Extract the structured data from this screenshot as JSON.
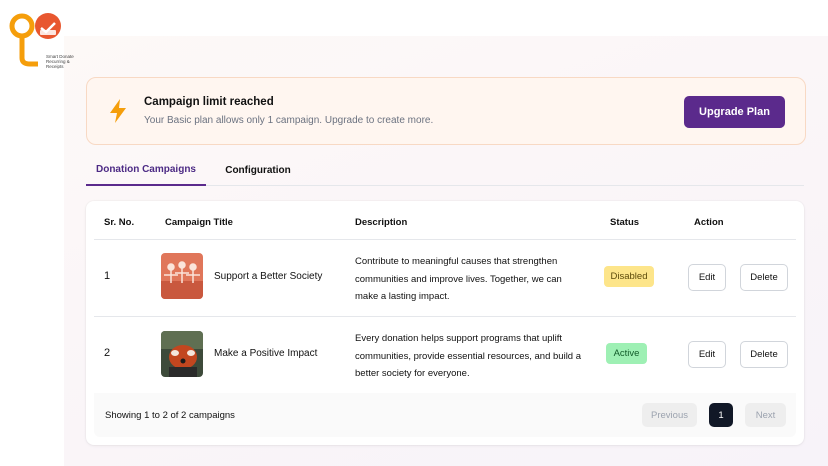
{
  "brand": {
    "logo_text": "Smart Donate Recurring & Receipts",
    "colors": {
      "orange": "#f59e0b",
      "accent": "#5b2a8c"
    }
  },
  "alert": {
    "icon": "lightning-icon",
    "title": "Campaign limit reached",
    "description": "Your Basic plan allows only 1 campaign. Upgrade to create more.",
    "button_label": "Upgrade Plan"
  },
  "tabs": [
    {
      "label": "Donation Campaigns",
      "active": true
    },
    {
      "label": "Configuration",
      "active": false
    }
  ],
  "table": {
    "headers": [
      "Sr. No.",
      "Campaign Title",
      "Description",
      "Status",
      "Action"
    ],
    "rows": [
      {
        "sr": "1",
        "title": "Support a Better Society",
        "description": "Contribute to meaningful causes that strengthen communities and improve lives. Together, we can make a lasting impact.",
        "status": "Disabled",
        "edit": "Edit",
        "delete": "Delete"
      },
      {
        "sr": "2",
        "title": "Make a Positive Impact",
        "description": "Every donation helps support programs that uplift communities, provide essential resources, and build a better society for everyone.",
        "status": "Active",
        "edit": "Edit",
        "delete": "Delete"
      }
    ]
  },
  "pagination": {
    "summary": "Showing 1 to 2 of 2 campaigns",
    "previous": "Previous",
    "current_page": "1",
    "next": "Next"
  }
}
